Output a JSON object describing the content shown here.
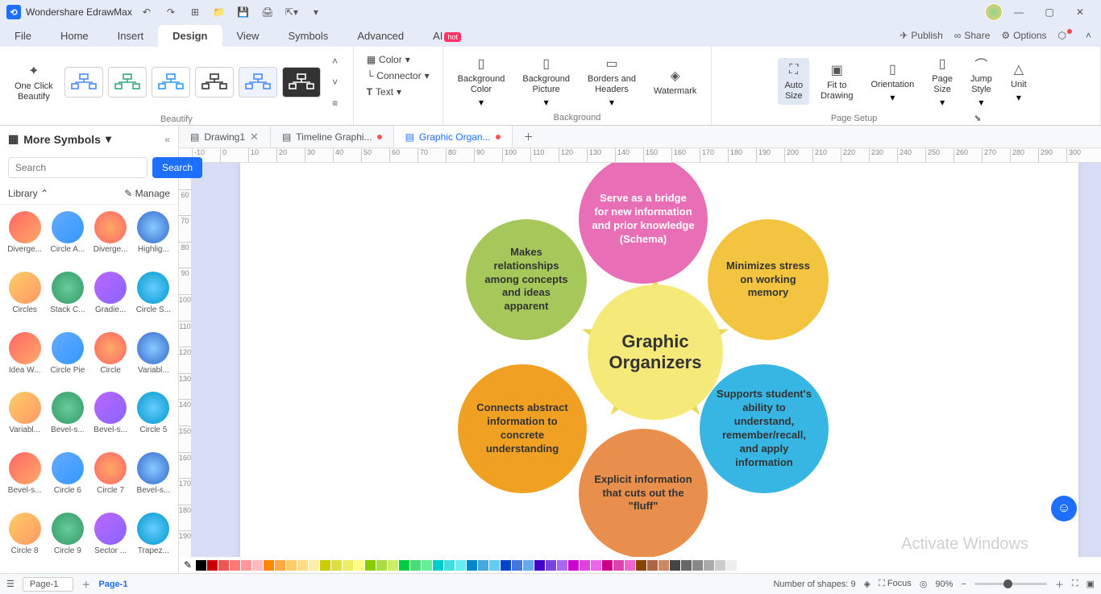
{
  "app": {
    "title": "Wondershare EdrawMax"
  },
  "menu": {
    "tabs": [
      "File",
      "Home",
      "Insert",
      "Design",
      "View",
      "Symbols",
      "Advanced",
      "AI"
    ],
    "active": "Design",
    "ai_badge": "hot",
    "right": {
      "publish": "Publish",
      "share": "Share",
      "options": "Options"
    }
  },
  "ribbon": {
    "beautify": {
      "one_click": "One Click\nBeautify",
      "group": "Beautify"
    },
    "format": {
      "color": "Color",
      "connector": "Connector",
      "text": "Text"
    },
    "background": {
      "bg_color": "Background\nColor",
      "bg_picture": "Background\nPicture",
      "borders": "Borders and\nHeaders",
      "watermark": "Watermark",
      "group": "Background"
    },
    "page_setup": {
      "auto_size": "Auto\nSize",
      "fit": "Fit to\nDrawing",
      "orientation": "Orientation",
      "page_size": "Page\nSize",
      "jump_style": "Jump\nStyle",
      "unit": "Unit",
      "group": "Page Setup"
    }
  },
  "doctabs": [
    {
      "label": "Drawing1",
      "dirty": false,
      "active": false
    },
    {
      "label": "Timeline Graphi...",
      "dirty": true,
      "active": false
    },
    {
      "label": "Graphic Organ...",
      "dirty": true,
      "active": true
    }
  ],
  "leftpanel": {
    "title": "More Symbols",
    "search_placeholder": "Search",
    "search_btn": "Search",
    "library": "Library",
    "manage": "Manage",
    "items": [
      "Diverge...",
      "Circle A...",
      "Diverge...",
      "Highlig...",
      "Circles",
      "Stack C...",
      "Gradie...",
      "Circle S...",
      "Idea W...",
      "Circle Pie",
      "Circle",
      "Variabl...",
      "Variabl...",
      "Bevel-s...",
      "Bevel-s...",
      "Circle 5",
      "Bevel-s...",
      "Circle 6",
      "Circle 7",
      "Bevel-s...",
      "Circle 8",
      "Circle 9",
      "Sector ...",
      "Trapez..."
    ]
  },
  "diagram": {
    "center": "Graphic\nOrganizers",
    "bubbles": [
      {
        "text": "Serve as a bridge for new information and prior knowledge (Schema)",
        "color": "#e86fb5"
      },
      {
        "text": "Minimizes stress on working memory",
        "color": "#f3c440"
      },
      {
        "text": "Supports student's ability to understand, remember/recall, and apply information",
        "color": "#38b6e3"
      },
      {
        "text": "Explicit information that cuts out the \"fluff\"",
        "color": "#e98f4e"
      },
      {
        "text": "Connects abstract information to concrete understanding",
        "color": "#f0a124"
      },
      {
        "text": "Makes relationships among concepts and ideas apparent",
        "color": "#a6c85b"
      }
    ]
  },
  "status": {
    "page_label": "Page-1",
    "active_page": "Page-1",
    "shapes": "Number of shapes: 9",
    "focus": "Focus",
    "zoom": "90%"
  },
  "watermark": "Activate Windows"
}
